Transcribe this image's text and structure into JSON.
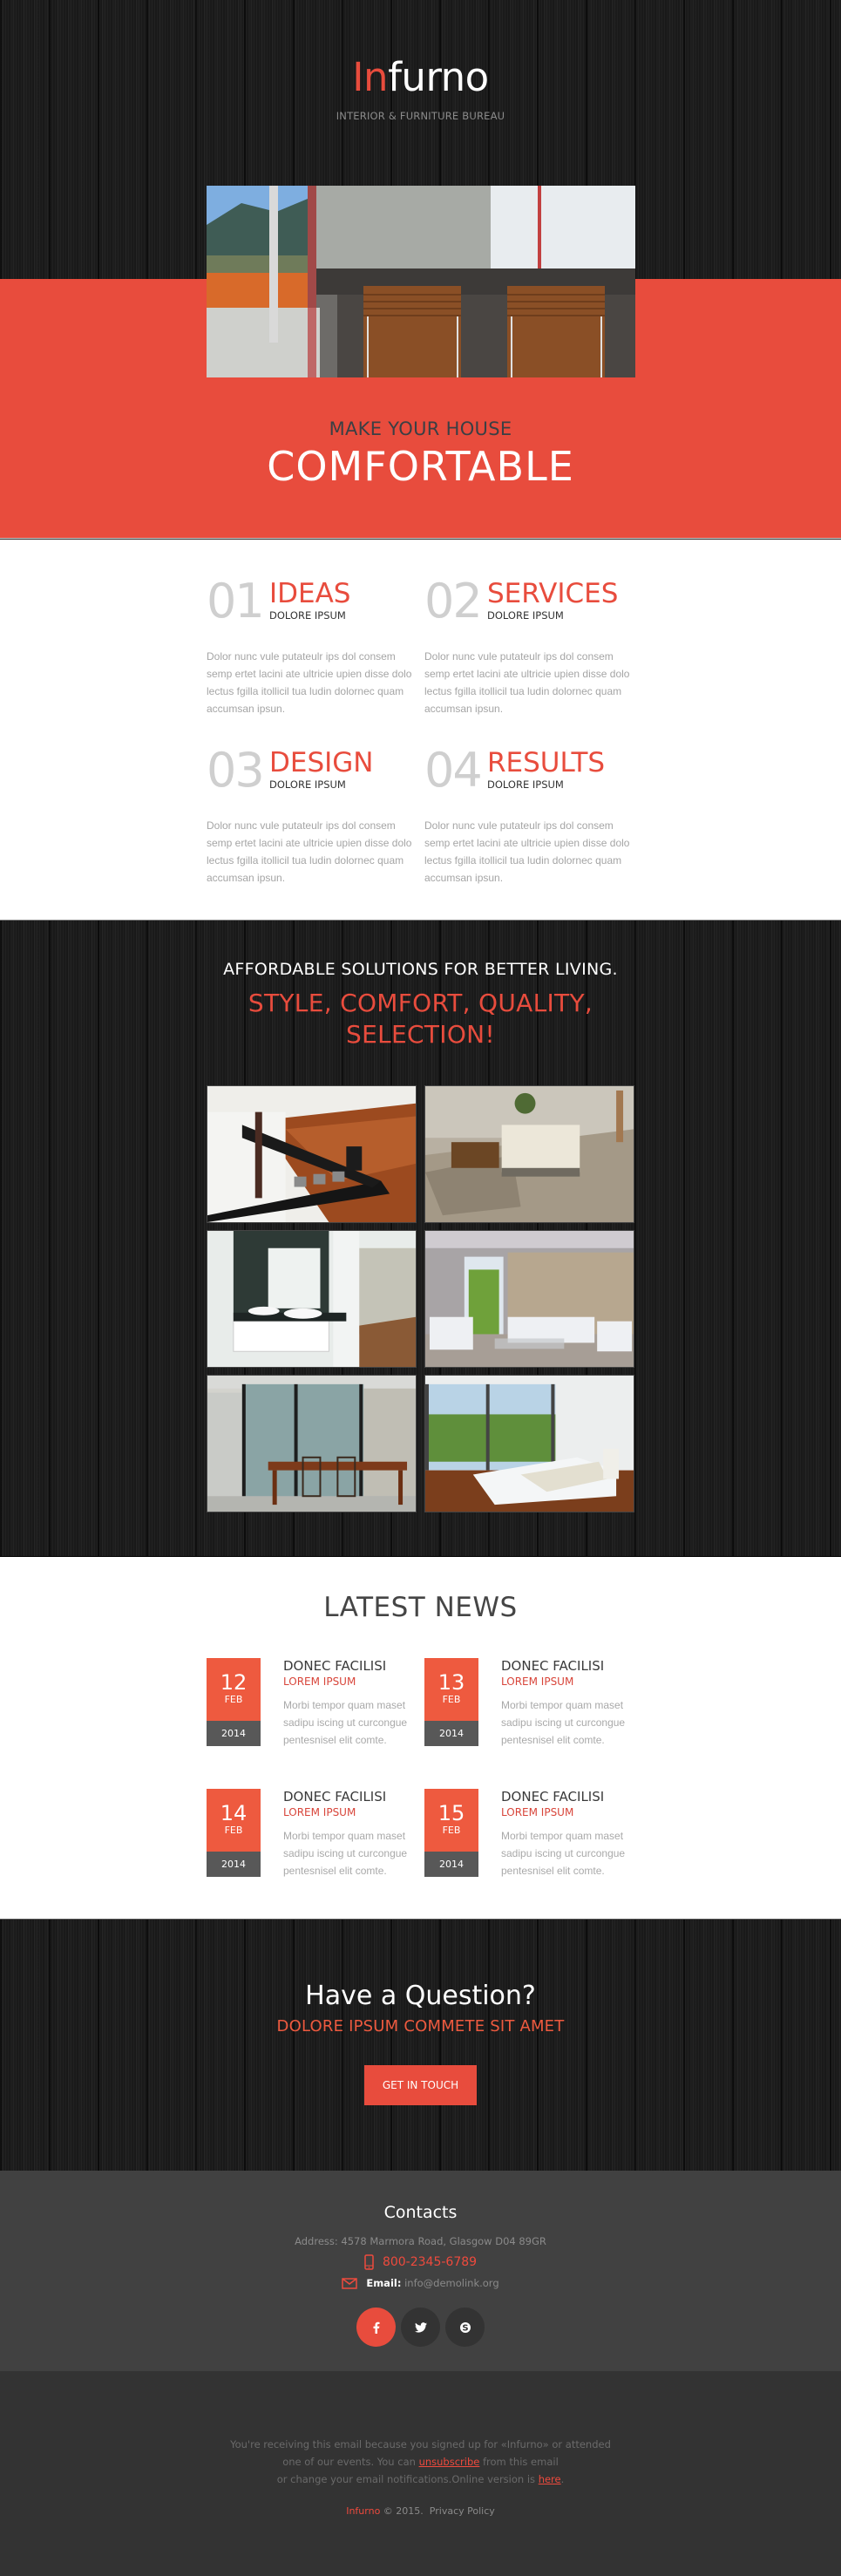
{
  "brand": {
    "logo_accent": "In",
    "logo_rest": "furno",
    "tagline": "INTERIOR & FURNITURE BUREAU",
    "accent_color": "#e84c3d"
  },
  "hero": {
    "image_alt": "modern kitchen with bar stools",
    "subtitle": "MAKE YOUR HOUSE",
    "title": "COMFORTABLE"
  },
  "features": [
    {
      "number": "01",
      "title": "IDEAS",
      "subtitle": "DOLORE IPSUM",
      "body": "Dolor nunc vule putateulr ips dol consem semp ertet lacini ate ultricie upien disse dolo lectus fgilla itollicil tua ludin dolornec quam accumsan ipsun."
    },
    {
      "number": "02",
      "title": "SERVICES",
      "subtitle": "DOLORE IPSUM",
      "body": "Dolor nunc vule putateulr ips dol consem semp ertet lacini ate ultricie upien disse dolo lectus fgilla itollicil tua ludin dolornec quam accumsan ipsun."
    },
    {
      "number": "03",
      "title": "DESIGN",
      "subtitle": "DOLORE IPSUM",
      "body": "Dolor nunc vule putateulr ips dol consem semp ertet lacini ate ultricie upien disse dolo lectus fgilla itollicil tua ludin dolornec quam accumsan ipsun."
    },
    {
      "number": "04",
      "title": "RESULTS",
      "subtitle": "DOLORE IPSUM",
      "body": "Dolor nunc vule putateulr ips dol consem semp ertet lacini ate ultricie upien disse dolo lectus fgilla itollicil tua ludin dolornec quam accumsan ipsun."
    }
  ],
  "gallery": {
    "kicker": "AFFORDABLE SOLUTIONS FOR BETTER LIVING.",
    "headline_line1": "STYLE, COMFORT, QUALITY,",
    "headline_line2": "SELECTION!",
    "photos": [
      {
        "alt": "bathroom with wood floor"
      },
      {
        "alt": "living room with white sofa"
      },
      {
        "alt": "modern bathroom with sinks"
      },
      {
        "alt": "living room with white couches"
      },
      {
        "alt": "dining room with wooden table"
      },
      {
        "alt": "bedroom with large windows"
      }
    ]
  },
  "news": {
    "title": "LATEST NEWS",
    "items": [
      {
        "day": "12",
        "month": "FEB",
        "year": "2014",
        "headline": "DONEC FACILISI",
        "subhead": "LOREM IPSUM",
        "body": "Morbi tempor quam maset sadipu iscing ut curcongue pentesnisel elit comte."
      },
      {
        "day": "13",
        "month": "FEB",
        "year": "2014",
        "headline": "DONEC FACILISI",
        "subhead": "LOREM IPSUM",
        "body": "Morbi tempor quam maset sadipu iscing ut curcongue pentesnisel elit comte."
      },
      {
        "day": "14",
        "month": "FEB",
        "year": "2014",
        "headline": "DONEC FACILISI",
        "subhead": "LOREM IPSUM",
        "body": "Morbi tempor quam maset sadipu iscing ut curcongue pentesnisel elit comte."
      },
      {
        "day": "15",
        "month": "FEB",
        "year": "2014",
        "headline": "DONEC FACILISI",
        "subhead": "LOREM IPSUM",
        "body": "Morbi tempor quam maset sadipu iscing ut curcongue pentesnisel elit comte."
      }
    ]
  },
  "cta": {
    "title": "Have a Question?",
    "subtitle": "DOLORE IPSUM COMMETE SIT AMET",
    "button_label": "GET IN TOUCH"
  },
  "contacts": {
    "title": "Contacts",
    "address": "Address: 4578 Marmora Road, Glasgow D04 89GR",
    "phone": "800-2345-6789",
    "email_label": "Email:",
    "email": "info@demolink.org",
    "social": [
      {
        "name": "facebook",
        "glyph": "f"
      },
      {
        "name": "twitter",
        "glyph": "t"
      },
      {
        "name": "skype",
        "glyph": "S"
      }
    ]
  },
  "footer": {
    "note_part1": "You're receiving this email because you signed up for «Infurno» or attended",
    "note_part2": "one of our events. You can ",
    "unsubscribe_label": "unsubscribe",
    "note_part3": " from this email",
    "note_part4": "or change your email notifications.Online version is ",
    "here_label": "here",
    "note_part5": ".",
    "brand": "Infurno",
    "copyright": " © 2015.",
    "privacy_label": "Privacy Policy"
  }
}
